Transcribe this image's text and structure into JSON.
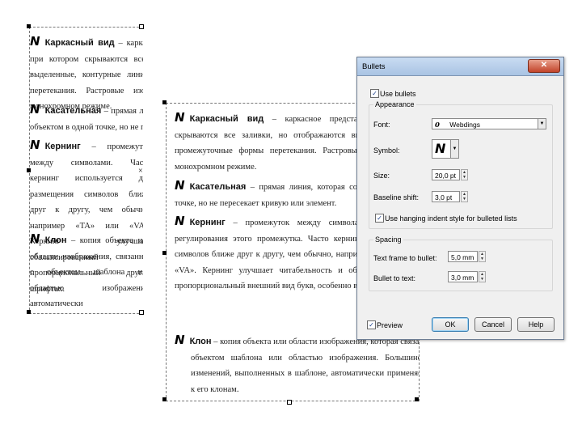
{
  "back_page": {
    "paragraphs": [
      {
        "term": "Каркасный вид",
        "text": " – каркасное представление рисунка, при котором скрываются все заливки, но отображаются выделенные, контурные линии и промежуточные формы перетекания. Растровые изображения отображаются в монохромном режиме."
      },
      {
        "term": "Касательная",
        "text": " – прямая линия, которая соприкасается с объектом в одной точке, но не пересекает кривую."
      },
      {
        "term": "Кернинг",
        "text": " – промежуток между символами. Часто кернинг используется для размещения символов ближе друг к другу, чем обычно, например «TA» или «VA». Кернинг улучшает сбалансированный и пропорциональный других шрифтах."
      },
      {
        "term": "Клон",
        "text": " – копия объекта или области изображения, связанная с объектом шаблона или областью изображения, автоматически"
      }
    ]
  },
  "front_page": {
    "paragraphs": [
      {
        "term": "Каркасный вид",
        "text": " – каркасное представление рисунка, при котором скрываются все заливки, но отображаются выделенные, контурные линии и промежуточные формы перетекания. Растровые изображения отображаются в монохромном режиме."
      },
      {
        "term": "Касательная",
        "text": " – прямая линия, которая соприкасается с объектом в одной точке, но не пересекает кривую или элемент."
      },
      {
        "term": "Кернинг",
        "text": " – промежуток между символами, и типографская операция регулирования этого промежутка. Часто кернинг используется для размещения символов ближе друг к другу, чем обычно, например букв «WA», «AW», «TA» или «VA». Кернинг улучшает читабельность и обеспечивает сбалансированный и пропорциональный внешний вид букв, особенно в крупных шрифтах."
      },
      {
        "term": "Клон",
        "text": " – копия объекта или области изображения, которая связана с объектом шаблона или областью изображения. Большинство изменений, выполненных в шаблоне, автоматически применяется к его клонам."
      }
    ]
  },
  "dialog": {
    "title": "Bullets",
    "close_glyph": "✕",
    "use_bullets_label": "Use bullets",
    "appearance_label": "Appearance",
    "font_label": "Font:",
    "font_glyph": "0",
    "font_value": "Webdings",
    "symbol_label": "Symbol:",
    "symbol_glyph": "𝘕",
    "size_label": "Size:",
    "size_value": "20,0 pt",
    "baseline_label": "Baseline shift:",
    "baseline_value": "3,0 pt",
    "hanging_label": "Use hanging indent style for bulleted lists",
    "spacing_label": "Spacing",
    "text_frame_label": "Text frame to bullet:",
    "text_frame_value": "5,0 mm",
    "bullet_text_label": "Bullet to text:",
    "bullet_text_value": "3,0 mm",
    "preview_label": "Preview",
    "ok_label": "OK",
    "cancel_label": "Cancel",
    "help_label": "Help"
  }
}
